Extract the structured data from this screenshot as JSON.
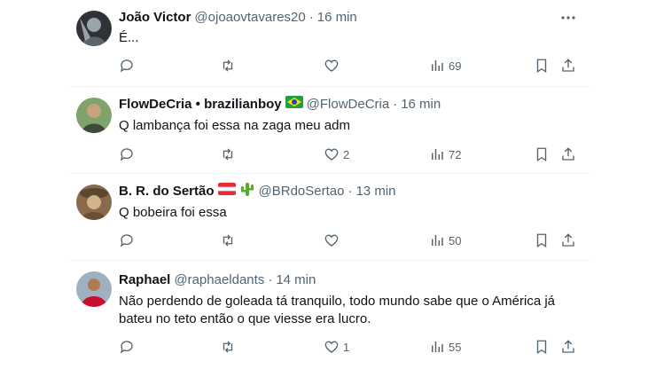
{
  "tweets": [
    {
      "name": "João Victor",
      "handle": "@ojoaovtavares20",
      "time": "16 min",
      "text": "É...",
      "replies": "",
      "reposts": "",
      "likes": "",
      "views": "69",
      "avatar_colors": [
        "#3a3f44",
        "#9aa4ad"
      ]
    },
    {
      "name": "FlowDeCria • brazilianboy",
      "handle": "@FlowDeCria",
      "time": "16 min",
      "text": "Q lambança foi essa na zaga meu adm",
      "replies": "",
      "reposts": "",
      "likes": "2",
      "views": "72",
      "avatar_colors": [
        "#6b8f5a",
        "#c9a27a"
      ]
    },
    {
      "name": "B. R. do Sertão",
      "handle": "@BRdoSertao",
      "time": "13 min",
      "text": "Q bobeira foi essa",
      "replies": "",
      "reposts": "",
      "likes": "",
      "views": "50",
      "avatar_colors": [
        "#5b4632",
        "#d2b48c"
      ]
    },
    {
      "name": "Raphael",
      "handle": "@raphaeldants",
      "time": "14 min",
      "text_line1": "Não perdendo de goleada tá tranquilo, todo mundo sabe que o América já",
      "text_line2": "bateu no teto então o que viesse era lucro.",
      "replies": "",
      "reposts": "",
      "likes": "1",
      "views": "55",
      "avatar_colors": [
        "#c8102e",
        "#7a8b99"
      ]
    }
  ],
  "separator": "·",
  "icons": [
    "reply-icon",
    "repost-icon",
    "like-icon",
    "views-icon",
    "bookmark-icon",
    "share-icon",
    "more-icon"
  ]
}
